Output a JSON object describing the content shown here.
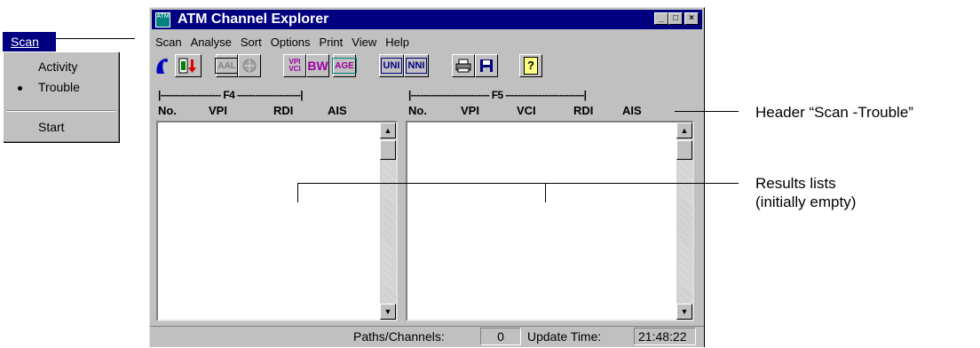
{
  "scan_menu": {
    "label": "Scan",
    "items": [
      {
        "label": "Activity",
        "checked": false
      },
      {
        "label": "Trouble",
        "checked": true
      },
      {
        "label": "Start",
        "checked": false
      }
    ]
  },
  "window": {
    "title": "ATM Channel Explorer",
    "icon_text": "ATM",
    "controls": {
      "minimize": "_",
      "maximize": "□",
      "close": "×"
    }
  },
  "menubar": [
    "Scan",
    "Analyse",
    "Sort",
    "Options",
    "Print",
    "View",
    "Help"
  ],
  "toolbar": {
    "tools": [
      {
        "name": "scan-icon",
        "label": "Scan"
      },
      {
        "name": "stop-icon",
        "label": "Stop"
      },
      {
        "name": "aal-icon",
        "label": "AAL"
      },
      {
        "name": "cell-icon",
        "label": "Cell"
      },
      {
        "name": "vpi-vci-icon",
        "label": "VPI VCI"
      },
      {
        "name": "bw-icon",
        "label": "BW"
      },
      {
        "name": "age-icon",
        "label": "AGE"
      },
      {
        "name": "uni-icon",
        "label": "UNI"
      },
      {
        "name": "nni-icon",
        "label": "NNI"
      },
      {
        "name": "print-icon",
        "label": "Print"
      },
      {
        "name": "save-icon",
        "label": "Save"
      },
      {
        "name": "help-icon",
        "label": "?"
      }
    ]
  },
  "f4": {
    "header": "|-------------------- F4 ---------------------|",
    "columns": [
      "No.",
      "VPI",
      "RDI",
      "AIS"
    ],
    "rows": []
  },
  "f5": {
    "header": "|-------------------------- F5 --------------------------|",
    "columns": [
      "No.",
      "VPI",
      "VCI",
      "RDI",
      "AIS"
    ],
    "rows": []
  },
  "status": {
    "paths_label": "Paths/Channels:",
    "paths_value": "0",
    "update_label": "Update Time:",
    "update_value": "21:48:22"
  },
  "annotations": {
    "header": "Header “Scan -Trouble”",
    "results_line1": "Results lists",
    "results_line2": "(initially empty)"
  }
}
